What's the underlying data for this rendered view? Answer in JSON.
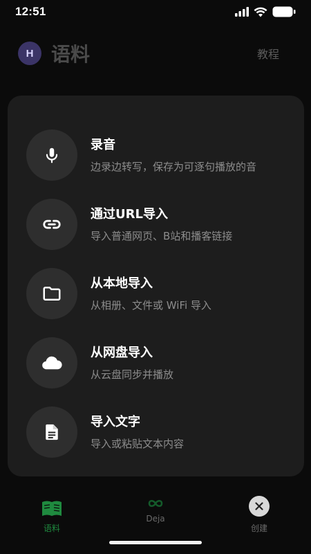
{
  "status_bar": {
    "time": "12:51"
  },
  "header": {
    "avatar_initial": "H",
    "title": "语料",
    "tutorial_label": "教程"
  },
  "options": [
    {
      "icon": "microphone-icon",
      "title": "录音",
      "desc": "边录边转写，保存为可逐句播放的音"
    },
    {
      "icon": "link-icon",
      "title": "通过URL导入",
      "desc": "导入普通网页、B站和播客链接"
    },
    {
      "icon": "folder-icon",
      "title": "从本地导入",
      "desc": "从相册、文件或 WiFi 导入"
    },
    {
      "icon": "cloud-icon",
      "title": "从网盘导入",
      "desc": "从云盘同步并播放"
    },
    {
      "icon": "document-icon",
      "title": "导入文字",
      "desc": "导入或粘贴文本内容"
    }
  ],
  "tabs": [
    {
      "icon": "book-icon",
      "label": "语料",
      "active": true
    },
    {
      "icon": "infinity-icon",
      "label": "Deja",
      "active": false
    },
    {
      "icon": "close-icon",
      "label": "创建",
      "active": false
    }
  ],
  "colors": {
    "background": "#0b0b0b",
    "sheet": "#1d1d1d",
    "icon_circle": "#2e2e2e",
    "accent_green": "#1f8a3f",
    "avatar_bg": "#3b3467"
  }
}
